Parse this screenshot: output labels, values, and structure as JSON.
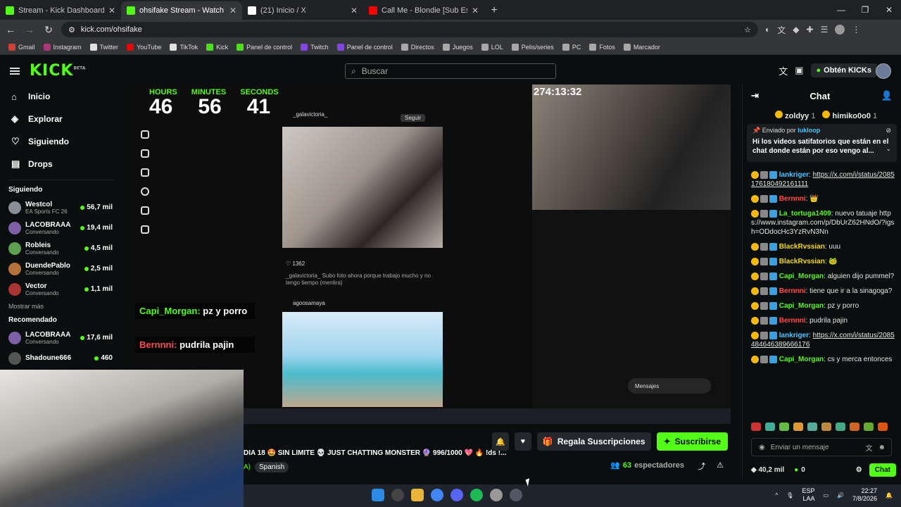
{
  "browser": {
    "tabs": [
      {
        "label": "Stream - Kick Dashboard",
        "color": "#53fc18",
        "active": false
      },
      {
        "label": "ohsifake Stream - Watch Live on",
        "color": "#53fc18",
        "active": true
      },
      {
        "label": "(21) Inicio / X",
        "color": "#ffffff",
        "active": false
      },
      {
        "label": "Call Me - Blondie [Sub Español]",
        "color": "#ff0000",
        "active": false
      }
    ],
    "url": "kick.com/ohsifake",
    "bookmarks": [
      "Gmail",
      "Instagram",
      "Twitter",
      "YouTube",
      "TikTok",
      "Kick",
      "Panel de control",
      "Twitch",
      "Panel de control",
      "Directos",
      "Juegos",
      "LOL",
      "Pelis/series",
      "PC",
      "Fotos",
      "Marcador"
    ]
  },
  "header": {
    "logo": "KICK",
    "logo_sup": "BETA",
    "search_placeholder": "Buscar",
    "kicks_label": "Obtén KICKs"
  },
  "sidebar": {
    "nav": [
      {
        "label": "Inicio",
        "icon": "home-icon"
      },
      {
        "label": "Explorar",
        "icon": "compass-icon"
      },
      {
        "label": "Siguiendo",
        "icon": "heart-icon"
      },
      {
        "label": "Drops",
        "icon": "drops-icon"
      }
    ],
    "following_title": "Siguiendo",
    "following": [
      {
        "name": "Westcol",
        "category": "EA Sports FC 26",
        "viewers": "56,7 mil",
        "color": "#8a8f96"
      },
      {
        "name": "LACOBRAAA",
        "category": "Conversando",
        "viewers": "19,4 mil",
        "color": "#7f5fa6"
      },
      {
        "name": "Robleis",
        "category": "Conversando",
        "viewers": "4,5 mil",
        "color": "#5ea04f"
      },
      {
        "name": "DuendePablo",
        "category": "Conversando",
        "viewers": "2,5 mil",
        "color": "#b7713a"
      },
      {
        "name": "Vector",
        "category": "Conversando",
        "viewers": "1,1 mil",
        "color": "#a33"
      }
    ],
    "show_more": "Mostrar más",
    "recommended_title": "Recomendado",
    "recommended": [
      {
        "name": "LACOBRAAA",
        "category": "Conversando",
        "viewers": "17,6 mil",
        "color": "#7f5fa6"
      },
      {
        "name": "Shadoune666",
        "category": "",
        "viewers": "460",
        "color": "#555"
      }
    ]
  },
  "video": {
    "timer_labels": [
      "HOURS",
      "MINUTES",
      "SECONDS"
    ],
    "timer_values": [
      "46",
      "56",
      "41"
    ],
    "subathon_count": "274:13:32",
    "post1_user": "_galavictoria_",
    "post1_caption": "_galavictoria_ Subo foto ahora porque trabajo mucho y no tengo tiempo (mentira)",
    "post1_likes": "1362",
    "post2_user": "agoosamaya",
    "follow_label": "Seguir",
    "messages_label": "Mensajes",
    "overlay_chat": [
      {
        "user": "Capi_Morgan:",
        "text": "pz y porro"
      },
      {
        "user": "Bernnni:",
        "text": "pudrila pajin"
      }
    ]
  },
  "stream": {
    "title": "DIA 18 🤩 SIN LIMITE 💀 JUST CHATTING MONSTER 🔮 996/1000 💖 🔥 !ds !...",
    "language": "Spanish",
    "gift_label": "Regala Suscripciones",
    "subscribe_label": "Suscribirse",
    "viewers_count": "63",
    "viewers_label": "espectadores"
  },
  "chat": {
    "title": "Chat",
    "top_gifters": [
      {
        "name": "zoldyy",
        "count": "1"
      },
      {
        "name": "himiko0o0",
        "count": "1"
      }
    ],
    "pinned_by_label": "Enviado por",
    "pinned_by": "lukloop",
    "pinned_text": "Hi los videos satifatorios que están en el chat donde están por eso vengo al...",
    "messages": [
      {
        "user": "lankriger",
        "color": "#53c3fc",
        "text": "https://x.com/i/status/2085176180492161111",
        "link": true
      },
      {
        "user": "Bernnni",
        "color": "#ff4b4b",
        "text": "👑",
        "link": false
      },
      {
        "user": "La_tortuga1409",
        "color": "#53fc18",
        "text": "nuevo tatuaje https://www.instagram.com/p/DbUrZ62HNdO/?igsh=ODdocHc3YzRvN3Nn",
        "link": false
      },
      {
        "user": "BlackRvssian",
        "color": "#f5d90d",
        "text": "uuu",
        "link": false
      },
      {
        "user": "BlackRvssian",
        "color": "#f5d90d",
        "text": "🐸",
        "link": false
      },
      {
        "user": "Capi_Morgan",
        "color": "#53fc18",
        "text": "alguien dijo pummel?",
        "link": false
      },
      {
        "user": "Bernnni",
        "color": "#ff4b4b",
        "text": "tiene que ir a la sinagoga?",
        "link": false
      },
      {
        "user": "Capi_Morgan",
        "color": "#53fc18",
        "text": "pz y porro",
        "link": false
      },
      {
        "user": "Bernnni",
        "color": "#ff4b4b",
        "text": "pudrila pajin",
        "link": false
      },
      {
        "user": "lankriger",
        "color": "#53c3fc",
        "text": "https://x.com/i/status/2085484646389666176",
        "link": true
      },
      {
        "user": "Capi_Morgan",
        "color": "#53fc18",
        "text": "cs y merca entonces",
        "link": false
      }
    ],
    "input_placeholder": "Enviar un mensaje",
    "kicks_amount": "40,2 mil",
    "points": "0",
    "send_label": "Chat"
  },
  "os": {
    "lang": "ESP",
    "lang2": "LAA",
    "time": "22:27",
    "date": "7/8/2026"
  }
}
